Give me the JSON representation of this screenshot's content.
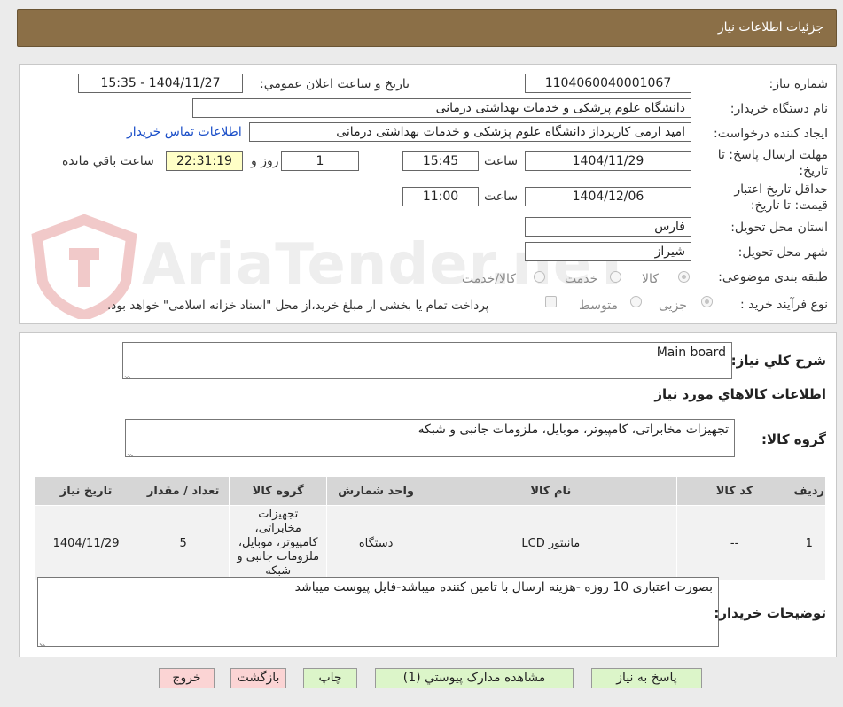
{
  "title": "جزئیات اطلاعات نیاز",
  "form": {
    "need_no_label": "شماره نیاز:",
    "need_no": "1104060040001067",
    "announce_label": "تاریخ و ساعت اعلان عمومي:",
    "announce_value": "1404/11/27 - 15:35",
    "buyer_label": "نام دستگاه خریدار:",
    "buyer_value": "دانشگاه علوم پزشکی و خدمات بهداشتی درمانی",
    "requester_label": "ایجاد کننده درخواست:",
    "requester_value": "امید  ارمی کارپرداز دانشگاه علوم پزشکی و خدمات بهداشتی درمانی",
    "contact_link": "اطلاعات تماس خریدار",
    "deadline_label": "مهلت ارسال پاسخ: تا تاریخ:",
    "deadline_date": "1404/11/29",
    "time_word": "ساعت",
    "deadline_time": "15:45",
    "days_value": "1",
    "days_word": "روز و",
    "remaining_time": "22:31:19",
    "remaining_word": "ساعت باقي مانده",
    "validity_label": "حداقل تاریخ اعتبار قیمت: تا تاریخ:",
    "validity_date": "1404/12/06",
    "validity_time": "11:00",
    "province_label": "استان محل تحویل:",
    "province_value": "فارس",
    "city_label": "شهر محل تحویل:",
    "city_value": "شیراز",
    "category_label": "طبقه بندی موضوعی:",
    "category_options": [
      "کالا",
      "خدمت",
      "کالا/خدمت"
    ],
    "category_selected": "کالا",
    "process_label": "نوع فرآیند خرید :",
    "process_options": [
      "جزیی",
      "متوسط"
    ],
    "process_selected": "جزیی",
    "treasury_text": "پرداخت تمام یا بخشی از مبلغ خرید،از محل \"اسناد خزانه اسلامی\" خواهد بود."
  },
  "details": {
    "summary_label": "شرح كلي نياز:",
    "summary_value": "Main board",
    "items_heading": "اطلاعات كالاهاي مورد نياز",
    "group_label": "گروه كالا:",
    "group_value": "تجهیزات مخابراتی، کامپیوتر، موبایل، ملزومات جانبی و شبکه",
    "table_headers": [
      "رديف",
      "كد كالا",
      "نام كالا",
      "واحد شمارش",
      "گروه كالا",
      "تعداد / مقدار",
      "تاريخ نياز"
    ],
    "rows": [
      {
        "row": "1",
        "code": "--",
        "name": "مانیتور LCD",
        "unit": "دستگاه",
        "group": "تجهیزات مخابراتی، کامپیوتر، موبایل، ملزومات جانبی و شبکه",
        "qty": "5",
        "date": "1404/11/29"
      }
    ],
    "notes_label": "توضیحات خریدار:",
    "notes_value": "بصورت اعتباری 10 روزه -هزینه ارسال با تامین کننده میباشد-فایل پیوست میباشد"
  },
  "buttons": {
    "reply": "پاسخ به نیاز",
    "attachments": "مشاهده مدارک پیوستي (1)",
    "print": "چاپ",
    "back": "بازگشت",
    "exit": "خروج"
  },
  "watermark": "AriaTender.neT",
  "colors": {
    "title_bar": "#8b6f47",
    "button_green": "#dcf5c9",
    "button_pink": "#fbd4d4",
    "remaining_bg": "#ffffc6",
    "link": "#1a4ec8"
  }
}
